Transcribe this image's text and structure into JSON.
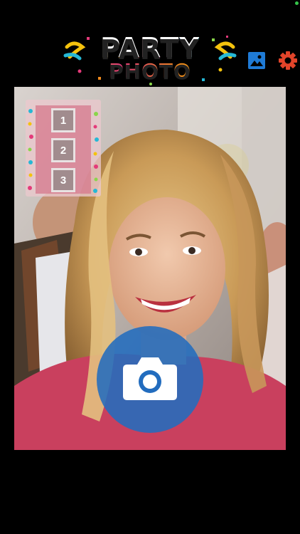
{
  "app": {
    "logo_line1": "PARTY",
    "logo_line2": "PHOTO"
  },
  "toolbar": {
    "gallery_icon": "image-gallery-icon",
    "settings_icon": "gear-icon"
  },
  "strip": {
    "slots": [
      "1",
      "2",
      "3"
    ]
  },
  "shutter": {
    "icon": "camera-icon"
  },
  "colors": {
    "background": "#000000",
    "accent_blue": "#1f7bd6",
    "settings_red": "#e2442a",
    "shutter_blue": "#226cbe"
  }
}
